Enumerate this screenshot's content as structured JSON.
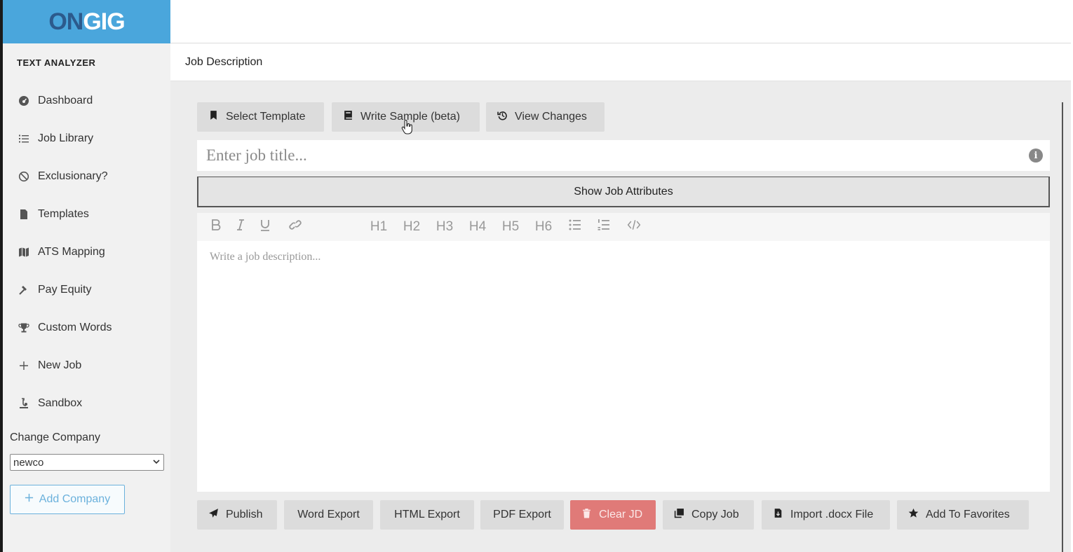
{
  "logo": {
    "part1": "ON",
    "part2": "GIG"
  },
  "sidebar": {
    "heading": "TEXT ANALYZER",
    "items": [
      {
        "label": "Dashboard",
        "icon": "dashboard-icon"
      },
      {
        "label": "Job Library",
        "icon": "list-icon"
      },
      {
        "label": "Exclusionary?",
        "icon": "ban-icon"
      },
      {
        "label": "Templates",
        "icon": "file-icon"
      },
      {
        "label": "ATS Mapping",
        "icon": "map-icon"
      },
      {
        "label": "Pay Equity",
        "icon": "gavel-icon"
      },
      {
        "label": "Custom Words",
        "icon": "trophy-icon"
      },
      {
        "label": "New Job",
        "icon": "plus-icon"
      },
      {
        "label": "Sandbox",
        "icon": "flask-icon"
      }
    ],
    "change_company_label": "Change Company",
    "company_value": "newco",
    "add_company_label": "Add Company"
  },
  "page": {
    "title": "Job Description"
  },
  "top_buttons": {
    "select_template": "Select Template",
    "write_sample": "Write Sample (beta)",
    "view_changes": "View Changes"
  },
  "job_title": {
    "placeholder": "Enter job title..."
  },
  "attributes_label": "Show Job Attributes",
  "editor": {
    "toolbar": {
      "h1": "H1",
      "h2": "H2",
      "h3": "H3",
      "h4": "H4",
      "h5": "H5",
      "h6": "H6"
    },
    "placeholder": "Write a job description..."
  },
  "bottom_buttons": {
    "publish": "Publish",
    "word_export": "Word Export",
    "html_export": "HTML Export",
    "pdf_export": "PDF Export",
    "clear_jd": "Clear JD",
    "copy_job": "Copy Job",
    "import_docx": "Import .docx File",
    "add_favorites": "Add To Favorites"
  },
  "colors": {
    "brand_blue": "#4aa6dc",
    "logo_dark": "#2c5a8c",
    "danger": "#e07a78",
    "content_bg": "#ececec"
  }
}
